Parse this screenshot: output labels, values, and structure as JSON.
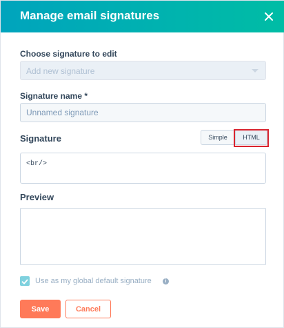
{
  "dialog": {
    "title": "Manage email signatures",
    "close_icon": "close-icon"
  },
  "choose": {
    "label": "Choose signature to edit",
    "value": "Add new signature"
  },
  "name": {
    "label": "Signature name *",
    "placeholder": "Unnamed signature",
    "value": ""
  },
  "signature": {
    "label": "Signature",
    "mode_options": [
      "Simple",
      "HTML"
    ],
    "selected_mode": "HTML",
    "content": "<br/>"
  },
  "preview": {
    "label": "Preview"
  },
  "global_default": {
    "label": "Use as my global default signature",
    "checked": true,
    "info_icon": "info-icon"
  },
  "actions": {
    "save_label": "Save",
    "cancel_label": "Cancel"
  },
  "colors": {
    "header_gradient_start": "#00a4bd",
    "header_gradient_end": "#00bda5",
    "primary": "#ff7a59",
    "highlight": "#d9232e",
    "text": "#33475b"
  }
}
